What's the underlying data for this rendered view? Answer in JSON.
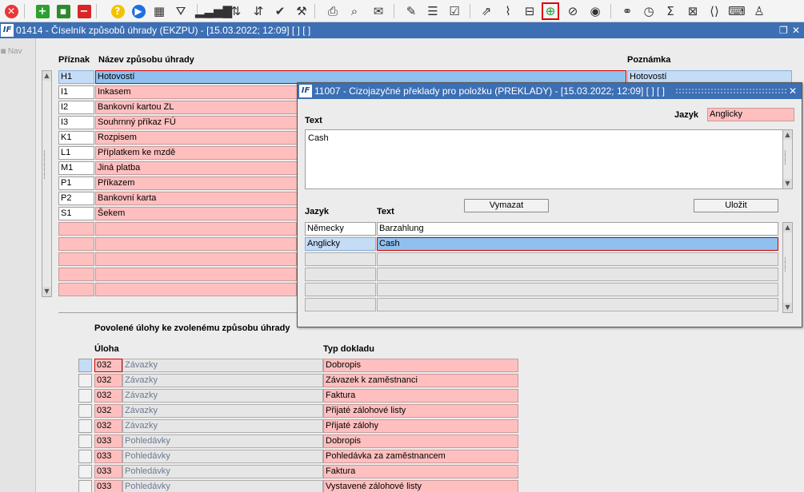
{
  "toolbar": {
    "buttons": [
      {
        "icon": "close-icon",
        "glyph": "✕",
        "color": "#e8373a",
        "shape": "circle"
      },
      {
        "icon": "add-icon",
        "glyph": "+",
        "color": "#2ea02e",
        "shape": "sq"
      },
      {
        "icon": "save-icon",
        "glyph": "▪",
        "color": "#2d8a2d",
        "shape": "sq"
      },
      {
        "icon": "delete-icon",
        "glyph": "−",
        "color": "#d82626",
        "shape": "sq"
      },
      {
        "icon": "help-icon",
        "glyph": "?",
        "color": "#f2c200",
        "shape": "circle"
      },
      {
        "icon": "play-icon",
        "glyph": "▶",
        "color": "#1f6fe0",
        "shape": "circle"
      },
      {
        "icon": "calendar-icon",
        "glyph": "▦"
      },
      {
        "icon": "filter-icon",
        "glyph": "⛛"
      },
      {
        "icon": "signal-icon",
        "glyph": "▂▃▅▇"
      },
      {
        "icon": "sort-asc-icon",
        "glyph": "⇅"
      },
      {
        "icon": "sort-desc-icon",
        "glyph": "⇵"
      },
      {
        "icon": "check-icon",
        "glyph": "✔"
      },
      {
        "icon": "wrench-icon",
        "glyph": "⚒"
      },
      {
        "icon": "print-icon",
        "glyph": "⎙"
      },
      {
        "icon": "print-preview-icon",
        "glyph": "⌕"
      },
      {
        "icon": "mail-icon",
        "glyph": "✉"
      },
      {
        "icon": "edit-icon",
        "glyph": "✎"
      },
      {
        "icon": "list-icon",
        "glyph": "☰"
      },
      {
        "icon": "checklist-icon",
        "glyph": "☑"
      },
      {
        "icon": "external-link-icon",
        "glyph": "⇗"
      },
      {
        "icon": "attachment-icon",
        "glyph": "⌇"
      },
      {
        "icon": "split-icon",
        "glyph": "⊟"
      },
      {
        "icon": "globe-icon",
        "glyph": "⊕",
        "color": "#1c9a3a",
        "active": true
      },
      {
        "icon": "compass-icon",
        "glyph": "⊘"
      },
      {
        "icon": "eye-icon",
        "glyph": "◉"
      },
      {
        "icon": "glasses-icon",
        "glyph": "⚭"
      },
      {
        "icon": "clock-icon",
        "glyph": "◷"
      },
      {
        "icon": "sum-icon",
        "glyph": "Σ"
      },
      {
        "icon": "excel-icon",
        "glyph": "⊠"
      },
      {
        "icon": "code-icon",
        "glyph": "⟨⟩"
      },
      {
        "icon": "keyboard-icon",
        "glyph": "⌨"
      },
      {
        "icon": "user-icon",
        "glyph": "♙"
      }
    ]
  },
  "main_window": {
    "title": "01414 - Číselník způsobů úhrady (EKZPU) - [15.03.2022; 12:09]  [ ] [ ]",
    "logo": "IF",
    "restore_glyph": "❐",
    "close_glyph": "✕"
  },
  "nav": {
    "label": "◙ Nav"
  },
  "payment_methods": {
    "col_flag": "Příznak",
    "col_name": "Název způsobu úhrady",
    "col_note": "Poznámka",
    "rows": [
      {
        "flag": "H1",
        "name": "Hotovostí",
        "note": "Hotovostí"
      },
      {
        "flag": "I1",
        "name": "Inkasem",
        "note": ""
      },
      {
        "flag": "I2",
        "name": "Bankovní kartou ZL",
        "note": ""
      },
      {
        "flag": "I3",
        "name": "Souhrnný příkaz FÚ",
        "note": ""
      },
      {
        "flag": "K1",
        "name": "Rozpisem",
        "note": ""
      },
      {
        "flag": "L1",
        "name": "Příplatkem ke mzdě",
        "note": ""
      },
      {
        "flag": "M1",
        "name": "Jiná platba",
        "note": ""
      },
      {
        "flag": "P1",
        "name": "Příkazem",
        "note": ""
      },
      {
        "flag": "P2",
        "name": "Bankovní karta",
        "note": ""
      },
      {
        "flag": "S1",
        "name": "Šekem",
        "note": ""
      }
    ],
    "empty_rows": 5
  },
  "tasks": {
    "section_title": "Povolené úlohy ke zvolenému způsobu úhrady",
    "col_task": "Úloha",
    "col_doc_type": "Typ dokladu",
    "rows": [
      {
        "code": "032",
        "module": "Závazky",
        "doc_type": "Dobropis"
      },
      {
        "code": "032",
        "module": "Závazky",
        "doc_type": "Závazek k zaměstnanci"
      },
      {
        "code": "032",
        "module": "Závazky",
        "doc_type": "Faktura"
      },
      {
        "code": "032",
        "module": "Závazky",
        "doc_type": "Přijaté zálohové listy"
      },
      {
        "code": "032",
        "module": "Závazky",
        "doc_type": "Přijaté zálohy"
      },
      {
        "code": "033",
        "module": "Pohledávky",
        "doc_type": "Dobropis"
      },
      {
        "code": "033",
        "module": "Pohledávky",
        "doc_type": "Pohledávka za zaměstnancem"
      },
      {
        "code": "033",
        "module": "Pohledávky",
        "doc_type": "Faktura"
      },
      {
        "code": "033",
        "module": "Pohledávky",
        "doc_type": "Vystavené zálohové listy"
      }
    ]
  },
  "dialog": {
    "title": "11007 - Cizojazyčné překlady pro položku (PREKLADY) - [15.03.2022; 12:09]  [ ] [ ]",
    "logo": "IF",
    "close_glyph": "✕",
    "text_label": "Text",
    "language_label": "Jazyk",
    "language_value": "Anglicky",
    "text_value": "Cash",
    "clear_button": "Vymazat",
    "save_button": "Uložit",
    "col_language": "Jazyk",
    "col_text": "Text",
    "rows": [
      {
        "language": "Německy",
        "text": "Barzahlung"
      },
      {
        "language": "Anglicky",
        "text": "Cash"
      }
    ],
    "empty_rows": 4
  }
}
